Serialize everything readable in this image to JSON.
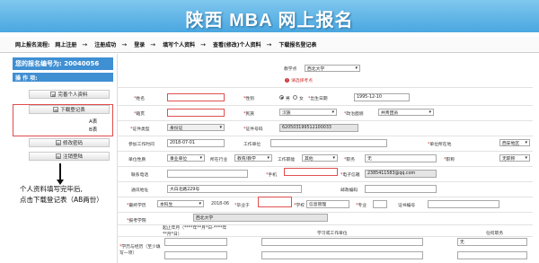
{
  "header": {
    "title": "陕西 MBA 网上报名"
  },
  "steps": {
    "label": "网上报名流程:",
    "items": [
      "网上注册",
      "注册成功",
      "登录",
      "填写个人资料",
      "查看(修改)个人资料",
      "下载报名登记表"
    ],
    "arrow": "→"
  },
  "sidebar": {
    "reg_number": "您的报名编号为: 20040056",
    "ops_title": "操 作 项:",
    "buttons": {
      "complete_info": "完善个人资料",
      "download_form": "下载登记表",
      "sub_a": "A表",
      "sub_b": "B表",
      "change_password": "修改密码",
      "logout": "注销登陆"
    },
    "note_line1": "个人资料填写完毕后,",
    "note_line2": "点击下载登记表（AB两份）"
  },
  "form": {
    "exam_site_label": "教学点",
    "exam_site_value": "西北大学",
    "error_tip": "请选择考点",
    "row1": {
      "name_label": "姓名",
      "gender_label": "性别",
      "gender_male": "男",
      "gender_female": "女",
      "birth_label": "出生日期",
      "birth_value": "1995-12-10"
    },
    "row2": {
      "origin_label": "籍贯",
      "ethnic_label": "民族",
      "ethnic_value": "汉族",
      "politics_label": "政治面貌",
      "politics_value": "共青团员"
    },
    "row3": {
      "idtype_label": "证件类型",
      "idtype_value": "身份证",
      "idno_label": "证件号码",
      "idno_value": "620503199512100033"
    },
    "row4": {
      "workstart_label": "参加工作时间",
      "workstart_value": "2018-07-01",
      "workplace_label": "工作单位",
      "location_label": "单位所在地",
      "location_value": "西安地区"
    },
    "row5": {
      "unitnature_label": "单位性质",
      "unitnature_value": "事业单位",
      "industry_label": "所在行业",
      "industry_value": "教育/教学",
      "worktime_label": "工作职能",
      "worktime_value": "其他",
      "position_label": "职务",
      "position_value": "无",
      "title_label": "职称",
      "title_value": "无职称"
    },
    "row6": {
      "phone_label": "联系电话",
      "mobile_label": "手机",
      "email_label": "电子信箱",
      "email_value": "2385411583@qq.com"
    },
    "row7": {
      "address_label": "通讯地址",
      "address_value": "大白北路229号",
      "postcode_label": "邮政编码"
    },
    "row8": {
      "degree_label": "最终学历",
      "degree_value": "本科生",
      "graddate_value": "2018-06",
      "certno_label": "毕业于",
      "school_label": "学校",
      "school_value": "信息管理",
      "major_label": "专业",
      "certno2_label": "证书编号"
    },
    "row9": {
      "adv_label": "报考学院",
      "adv_value": "西北大学"
    },
    "table": {
      "col1": "起止年月（****年**月*日-****年**月*日）",
      "col2": "学习或工作单位",
      "col3": "任何职务",
      "row_label": "学历与经历（至少填写一项）",
      "row_value": "无"
    }
  }
}
